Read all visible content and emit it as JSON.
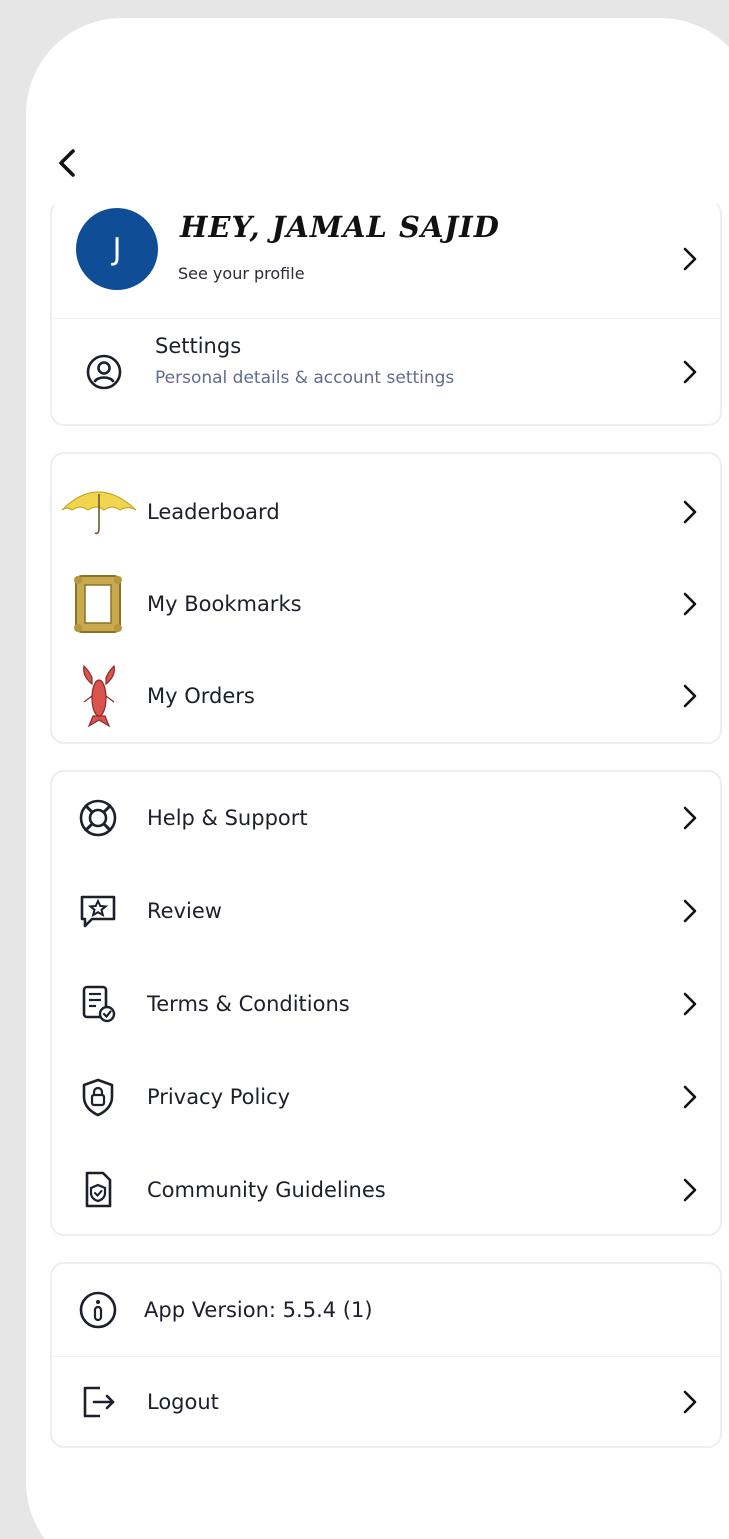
{
  "header": {
    "back_icon": "chevron-left-icon"
  },
  "profile": {
    "avatar_initial": "J",
    "greeting": "HEY, JAMAL SAJID",
    "subtitle": "See your profile"
  },
  "settings": {
    "title": "Settings",
    "subtitle": "Personal details & account settings"
  },
  "activity": {
    "items": [
      {
        "label": "Leaderboard",
        "icon": "yellow-umbrella-icon"
      },
      {
        "label": "My Bookmarks",
        "icon": "picture-frame-icon"
      },
      {
        "label": "My Orders",
        "icon": "lobster-icon"
      }
    ]
  },
  "info": {
    "items": [
      {
        "label": "Help & Support",
        "icon": "lifebuoy-icon"
      },
      {
        "label": "Review",
        "icon": "star-message-icon"
      },
      {
        "label": "Terms & Conditions",
        "icon": "document-check-icon"
      },
      {
        "label": "Privacy Policy",
        "icon": "shield-lock-icon"
      },
      {
        "label": "Community Guidelines",
        "icon": "document-shield-icon"
      }
    ]
  },
  "app": {
    "version_label": "App Version: 5.5.4 (1)",
    "logout_label": "Logout"
  },
  "colors": {
    "avatar_bg": "#0f4d96",
    "subtitle_text": "#626a8f",
    "card_border": "#eceef3"
  }
}
